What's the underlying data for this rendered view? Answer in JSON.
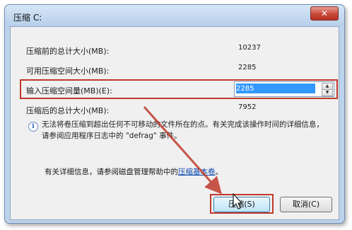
{
  "window": {
    "title": "压缩 C:",
    "close_label": "✕"
  },
  "rows": [
    {
      "label": "压缩前的总计大小(MB):",
      "value": "10237"
    },
    {
      "label": "可用压缩空间大小(MB):",
      "value": "2285"
    }
  ],
  "input_row": {
    "label": "输入压缩空间量(MB)(E):",
    "value": "2285"
  },
  "after_row": {
    "label": "压缩后的总计大小(MB):",
    "value": "7952"
  },
  "info": {
    "icon": "info-icon",
    "text": "无法将卷压缩到超出任何不可移动的文件所在的点。有关完成该操作时间的详细信息，请参阅应用程序日志中的 \"defrag\" 事件。"
  },
  "help": {
    "prefix": "有关详细信息，请参阅磁盘管理帮助中的",
    "link": "压缩基本卷",
    "suffix": "。"
  },
  "buttons": {
    "ok": "压缩(S)",
    "cancel": "取消(C)"
  },
  "colors": {
    "highlight": "#c0392b",
    "arrow": "#c0392b",
    "selection": "#3399ff"
  }
}
